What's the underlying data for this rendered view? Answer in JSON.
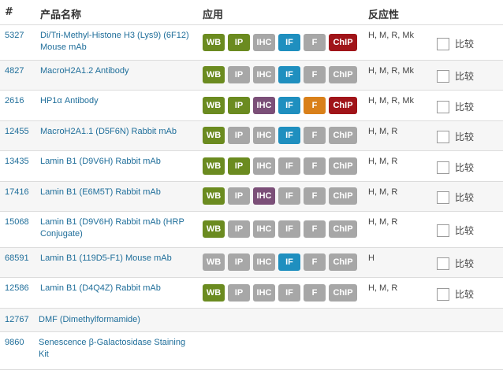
{
  "header": {
    "num": "#",
    "product": "产品名称",
    "applications": "应用",
    "reactivity": "反应性"
  },
  "compare_label": "比较",
  "badge_labels": [
    "WB",
    "IP",
    "IHC",
    "IF",
    "F",
    "ChIP"
  ],
  "badge_colors": {
    "inactive": "#a7a7a7",
    "WB": "#6b8b20",
    "IP": "#6b8b20",
    "IHC": "#7b4f78",
    "IF": "#1f8fbf",
    "F": "#d9801a",
    "ChIP": "#a01419"
  },
  "rows": [
    {
      "cat": "5327",
      "name": "Di/Tri-Methyl-Histone H3 (Lys9) (6F12) Mouse mAb",
      "active": [
        "WB",
        "IP",
        "IF",
        "ChIP"
      ],
      "reactivity": "H, M, R, Mk",
      "compare": true
    },
    {
      "cat": "4827",
      "name": "MacroH2A1.2 Antibody",
      "active": [
        "WB",
        "IF"
      ],
      "reactivity": "H, M, R, Mk",
      "compare": true
    },
    {
      "cat": "2616",
      "name": "HP1α Antibody",
      "active": [
        "WB",
        "IP",
        "IHC",
        "IF",
        "F",
        "ChIP"
      ],
      "reactivity": "H, M, R, Mk",
      "compare": true
    },
    {
      "cat": "12455",
      "name": "MacroH2A1.1 (D5F6N) Rabbit mAb",
      "active": [
        "WB",
        "IF"
      ],
      "reactivity": "H, M, R",
      "compare": true
    },
    {
      "cat": "13435",
      "name": "Lamin B1 (D9V6H) Rabbit mAb",
      "active": [
        "WB",
        "IP"
      ],
      "reactivity": "H, M, R",
      "compare": true
    },
    {
      "cat": "17416",
      "name": "Lamin B1 (E6M5T) Rabbit mAb",
      "active": [
        "WB",
        "IHC"
      ],
      "reactivity": "H, M, R",
      "compare": true
    },
    {
      "cat": "15068",
      "name": "Lamin B1 (D9V6H) Rabbit mAb (HRP Conjugate)",
      "active": [
        "WB"
      ],
      "reactivity": "H, M, R",
      "compare": true
    },
    {
      "cat": "68591",
      "name": "Lamin B1 (119D5-F1) Mouse mAb",
      "active": [
        "IF"
      ],
      "reactivity": "H",
      "compare": true
    },
    {
      "cat": "12586",
      "name": "Lamin B1 (D4Q4Z) Rabbit mAb",
      "active": [
        "WB"
      ],
      "reactivity": "H, M, R",
      "compare": true
    },
    {
      "cat": "12767",
      "name": "DMF (Dimethylformamide)",
      "active": [],
      "reactivity": "",
      "compare": false
    },
    {
      "cat": "9860",
      "name": "Senescence β-Galactosidase Staining Kit",
      "active": [],
      "reactivity": "",
      "compare": false
    }
  ]
}
